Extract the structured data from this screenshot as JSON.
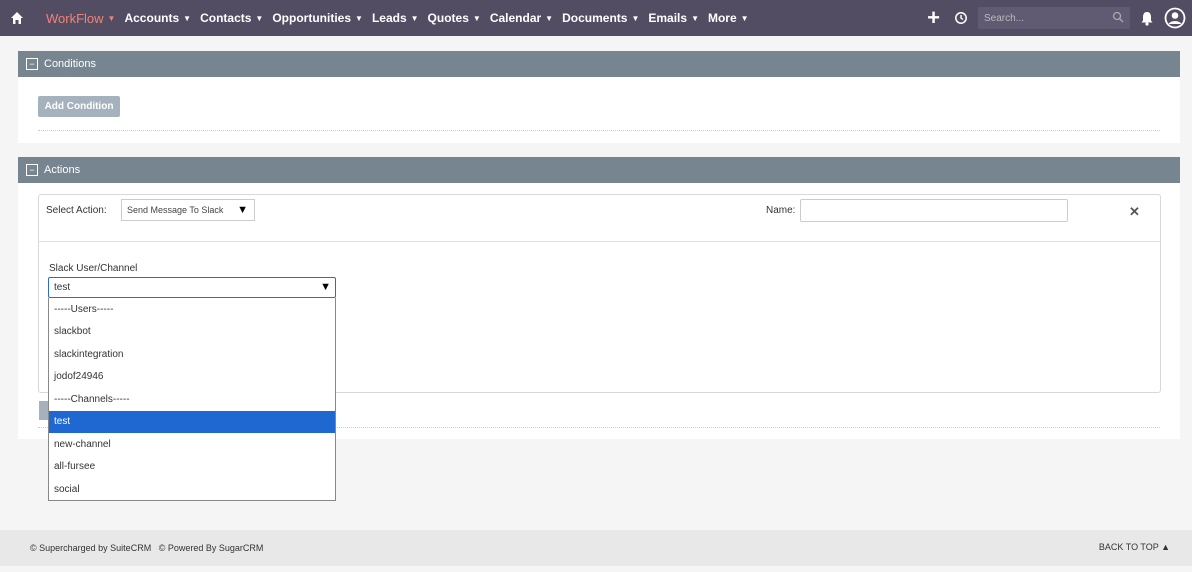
{
  "nav": {
    "items": [
      {
        "label": "WorkFlow",
        "active": true
      },
      {
        "label": "Accounts"
      },
      {
        "label": "Contacts"
      },
      {
        "label": "Opportunities"
      },
      {
        "label": "Leads"
      },
      {
        "label": "Quotes"
      },
      {
        "label": "Calendar"
      },
      {
        "label": "Documents"
      },
      {
        "label": "Emails"
      },
      {
        "label": "More"
      }
    ],
    "search_placeholder": "Search...",
    "icons": [
      "home-icon",
      "plus-icon",
      "recent-icon",
      "search-icon",
      "bell-icon",
      "user-icon"
    ],
    "colors": {
      "bar": "#534d64",
      "active": "#f08377"
    }
  },
  "conditions": {
    "title": "Conditions",
    "collapse_symbol": "−",
    "add_button": "Add Condition"
  },
  "actions": {
    "title": "Actions",
    "collapse_symbol": "−",
    "select_action_label": "Select Action:",
    "select_action_value": "Send Message To Slack",
    "name_label": "Name:",
    "name_value": "",
    "remove_symbol": "✕",
    "slack_label": "Slack User/Channel",
    "slack_value": "test",
    "dropdown_options": [
      {
        "label": "-----Users-----",
        "type": "header"
      },
      {
        "label": "slackbot"
      },
      {
        "label": "slackintegration"
      },
      {
        "label": "jodof24946"
      },
      {
        "label": "-----Channels-----",
        "type": "header"
      },
      {
        "label": "test",
        "selected": true
      },
      {
        "label": "new-channel"
      },
      {
        "label": "all-fursee"
      },
      {
        "label": "social"
      }
    ]
  },
  "footer": {
    "left": "© Supercharged by SuiteCRM   © Powered By SugarCRM",
    "back_to_top": "BACK TO TOP ▲"
  }
}
